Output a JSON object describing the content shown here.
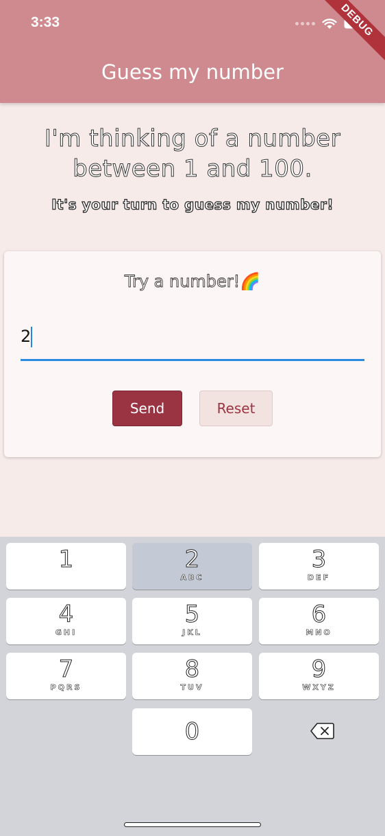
{
  "status_bar": {
    "time": "3:33",
    "icons": [
      "signal-dots",
      "wifi-icon",
      "battery-icon"
    ]
  },
  "app_bar": {
    "title": "Guess my number",
    "debug_banner": "DEBUG",
    "color": "#cf8a8f"
  },
  "main": {
    "headline_line1": "I'm thinking of a number",
    "headline_line2": "between 1 and 100.",
    "subline": "It's your turn to guess my number!"
  },
  "card": {
    "title": "Try a number!",
    "title_emoji": "🌈",
    "input_value": "2",
    "send_label": "Send",
    "reset_label": "Reset",
    "accent": "#9a3442",
    "underline_color": "#2a8ae0"
  },
  "keyboard": {
    "keys": [
      {
        "digit": "1",
        "letters": ""
      },
      {
        "digit": "2",
        "letters": "ABC"
      },
      {
        "digit": "3",
        "letters": "DEF"
      },
      {
        "digit": "4",
        "letters": "GHI"
      },
      {
        "digit": "5",
        "letters": "JKL"
      },
      {
        "digit": "6",
        "letters": "MNO"
      },
      {
        "digit": "7",
        "letters": "PQRS"
      },
      {
        "digit": "8",
        "letters": "TUV"
      },
      {
        "digit": "9",
        "letters": "WXYZ"
      },
      {
        "digit": "0",
        "letters": ""
      }
    ],
    "pressed_key": "2",
    "delete_icon": "backspace-icon"
  }
}
